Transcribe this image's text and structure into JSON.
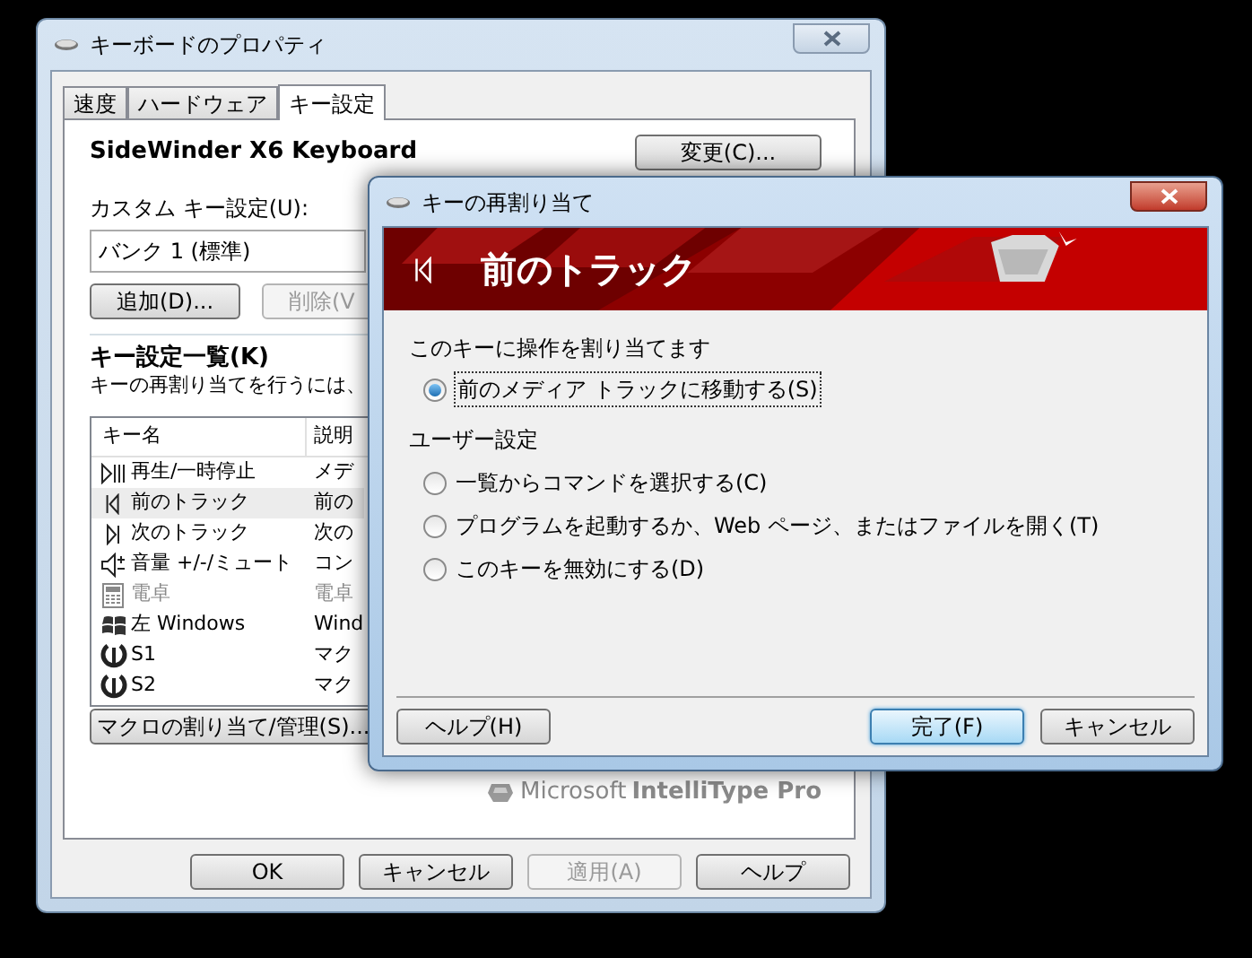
{
  "main_window": {
    "title": "キーボードのプロパティ",
    "tabs": [
      {
        "label": "速度",
        "selected": false
      },
      {
        "label": "ハードウェア",
        "selected": false
      },
      {
        "label": "キー設定",
        "selected": true
      }
    ],
    "device_name": "SideWinder X6 Keyboard",
    "change_button": "変更(C)...",
    "custom_label": "カスタム キー設定(U):",
    "custom_value": "バンク 1 (標準)",
    "add_button": "追加(D)...",
    "delete_button": {
      "label": "削除(V",
      "disabled": true
    },
    "list_heading": "キー設定一覧(K)",
    "list_hint": "キーの再割り当てを行うには、",
    "columns": [
      "キー名",
      "説明"
    ],
    "rows": [
      {
        "kind": "play-pause",
        "name": "再生/一時停止",
        "description": "メデ",
        "selected": false,
        "disabled": false
      },
      {
        "kind": "previous",
        "name": "前のトラック",
        "description": "前の",
        "selected": true,
        "disabled": false
      },
      {
        "kind": "next",
        "name": "次のトラック",
        "description": "次の",
        "selected": false,
        "disabled": false
      },
      {
        "kind": "volume",
        "name": "音量 +/-/ミュート",
        "description": "コン",
        "selected": false,
        "disabled": false
      },
      {
        "kind": "calculator",
        "name": "電卓",
        "description": "電卓",
        "selected": false,
        "disabled": true
      },
      {
        "kind": "windows",
        "name": "左 Windows",
        "description": "Wind",
        "selected": false,
        "disabled": false
      },
      {
        "kind": "macro",
        "name": "S1",
        "description": "マク",
        "selected": false,
        "disabled": false
      },
      {
        "kind": "macro",
        "name": "S2",
        "description": "マク",
        "selected": false,
        "disabled": false
      }
    ],
    "macro_button": "マクロの割り当て/管理(S)...",
    "brand": {
      "maker": "Microsoft",
      "product": "IntelliType Pro"
    },
    "buttons": [
      {
        "label": "OK",
        "disabled": false
      },
      {
        "label": "キャンセル",
        "disabled": false
      },
      {
        "label": "適用(A)",
        "disabled": true
      },
      {
        "label": "ヘルプ",
        "disabled": false
      }
    ]
  },
  "dialog": {
    "title": "キーの再割り当て",
    "header": "前のトラック",
    "assign_label": "このキーに操作を割り当てます",
    "default_option": {
      "label": "前のメディア トラックに移動する(S)",
      "selected": true
    },
    "user_label": "ユーザー設定",
    "options": [
      {
        "label": "一覧からコマンドを選択する(C)",
        "selected": false
      },
      {
        "label": "プログラムを起動するか、Web ページ、またはファイルを開く(T)",
        "selected": false
      },
      {
        "label": "このキーを無効にする(D)",
        "selected": false
      }
    ],
    "help_button": "ヘルプ(H)",
    "finish_button": "完了(F)",
    "cancel_button": "キャンセル"
  }
}
